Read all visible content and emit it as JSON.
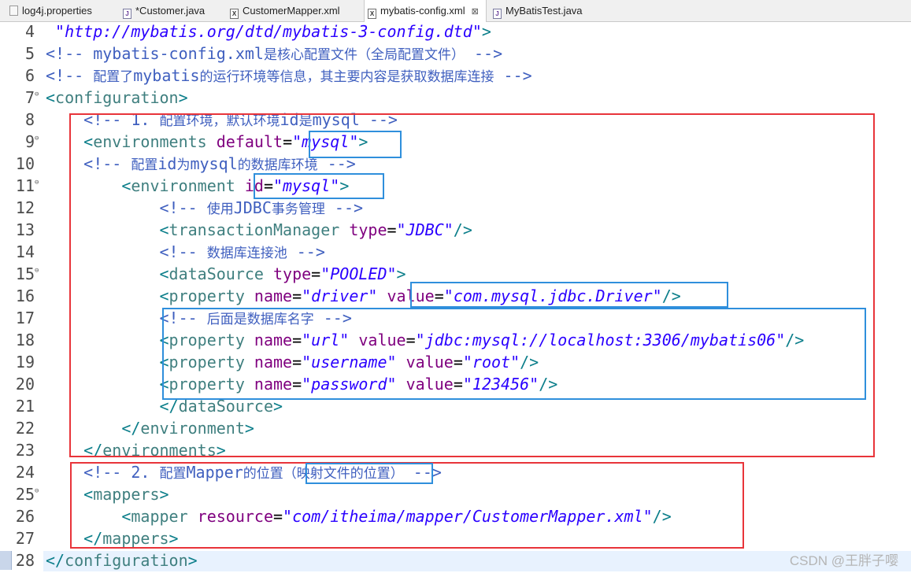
{
  "tabs": [
    {
      "label": "log4j.properties",
      "icon": "properties-file-icon"
    },
    {
      "label": "*Customer.java",
      "icon": "java-file-icon"
    },
    {
      "label": "CustomerMapper.xml",
      "icon": "xml-file-icon"
    },
    {
      "label": "mybatis-config.xml",
      "icon": "xml-file-icon",
      "active": true,
      "close": "⊠"
    },
    {
      "label": "MyBatisTest.java",
      "icon": "java-file-icon"
    }
  ],
  "lines": [
    {
      "n": "4",
      "fold": "",
      "segs": [
        {
          "c": "t-val",
          "t": " \"http://mybatis.org/dtd/mybatis-3-config.dtd\""
        },
        {
          "c": "t-tag",
          "t": ">"
        }
      ]
    },
    {
      "n": "5",
      "fold": "",
      "segs": [
        {
          "c": "t-com",
          "t": "<!-- mybatis-config.xml"
        },
        {
          "c": "t-cjk",
          "t": "是核心配置文件（全局配置文件）"
        },
        {
          "c": "t-com",
          "t": " -->"
        }
      ]
    },
    {
      "n": "6",
      "fold": "",
      "segs": [
        {
          "c": "t-com",
          "t": "<!-- "
        },
        {
          "c": "t-cjk",
          "t": "配置了"
        },
        {
          "c": "t-com",
          "t": "mybatis"
        },
        {
          "c": "t-cjk",
          "t": "的运行环境等信息，其主要内容是获取数据库连接"
        },
        {
          "c": "t-com",
          "t": " -->"
        }
      ]
    },
    {
      "n": "7",
      "fold": "⊖",
      "segs": [
        {
          "c": "t-tag",
          "t": "<"
        },
        {
          "c": "t-el",
          "t": "configuration"
        },
        {
          "c": "t-tag",
          "t": ">"
        }
      ]
    },
    {
      "n": "8",
      "fold": "",
      "segs": [
        {
          "c": "t-com",
          "t": "    <!-- 1. "
        },
        {
          "c": "t-cjk",
          "t": "配置环境，默认环境"
        },
        {
          "c": "t-com",
          "t": "id"
        },
        {
          "c": "t-cjk",
          "t": "是"
        },
        {
          "c": "t-com",
          "t": "mysql -->"
        }
      ]
    },
    {
      "n": "9",
      "fold": "⊖",
      "segs": [
        {
          "c": "t-tag",
          "t": "    <"
        },
        {
          "c": "t-el",
          "t": "environments "
        },
        {
          "c": "t-attr",
          "t": "default"
        },
        {
          "c": "t-txt",
          "t": "="
        },
        {
          "c": "t-val",
          "t": "\"mysql\""
        },
        {
          "c": "t-tag",
          "t": ">"
        }
      ]
    },
    {
      "n": "10",
      "fold": "",
      "segs": [
        {
          "c": "t-com",
          "t": "    <!-- "
        },
        {
          "c": "t-cjk",
          "t": "配置"
        },
        {
          "c": "t-com",
          "t": "id"
        },
        {
          "c": "t-cjk",
          "t": "为"
        },
        {
          "c": "t-com",
          "t": "mysql"
        },
        {
          "c": "t-cjk",
          "t": "的数据库环境"
        },
        {
          "c": "t-com",
          "t": " -->"
        }
      ]
    },
    {
      "n": "11",
      "fold": "⊖",
      "segs": [
        {
          "c": "t-tag",
          "t": "        <"
        },
        {
          "c": "t-el",
          "t": "environment "
        },
        {
          "c": "t-attr",
          "t": "id"
        },
        {
          "c": "t-txt",
          "t": "="
        },
        {
          "c": "t-val",
          "t": "\"mysql\""
        },
        {
          "c": "t-tag",
          "t": ">"
        }
      ]
    },
    {
      "n": "12",
      "fold": "",
      "segs": [
        {
          "c": "t-com",
          "t": "            <!-- "
        },
        {
          "c": "t-cjk",
          "t": "使用"
        },
        {
          "c": "t-com",
          "t": "JDBC"
        },
        {
          "c": "t-cjk",
          "t": "事务管理"
        },
        {
          "c": "t-com",
          "t": " -->"
        }
      ]
    },
    {
      "n": "13",
      "fold": "",
      "segs": [
        {
          "c": "t-tag",
          "t": "            <"
        },
        {
          "c": "t-el",
          "t": "transactionManager "
        },
        {
          "c": "t-attr",
          "t": "type"
        },
        {
          "c": "t-txt",
          "t": "="
        },
        {
          "c": "t-val",
          "t": "\"JDBC\""
        },
        {
          "c": "t-tag",
          "t": "/>"
        }
      ]
    },
    {
      "n": "14",
      "fold": "",
      "segs": [
        {
          "c": "t-com",
          "t": "            <!-- "
        },
        {
          "c": "t-cjk",
          "t": "数据库连接池"
        },
        {
          "c": "t-com",
          "t": " -->"
        }
      ]
    },
    {
      "n": "15",
      "fold": "⊖",
      "segs": [
        {
          "c": "t-tag",
          "t": "            <"
        },
        {
          "c": "t-el",
          "t": "dataSource "
        },
        {
          "c": "t-attr",
          "t": "type"
        },
        {
          "c": "t-txt",
          "t": "="
        },
        {
          "c": "t-val",
          "t": "\"POOLED\""
        },
        {
          "c": "t-tag",
          "t": ">"
        }
      ]
    },
    {
      "n": "16",
      "fold": "",
      "segs": [
        {
          "c": "t-tag",
          "t": "            <"
        },
        {
          "c": "t-el",
          "t": "property "
        },
        {
          "c": "t-attr",
          "t": "name"
        },
        {
          "c": "t-txt",
          "t": "="
        },
        {
          "c": "t-val",
          "t": "\"driver\" "
        },
        {
          "c": "t-attr",
          "t": "value"
        },
        {
          "c": "t-txt",
          "t": "="
        },
        {
          "c": "t-val",
          "t": "\"com.mysql.jdbc.Driver\""
        },
        {
          "c": "t-tag",
          "t": "/>"
        }
      ]
    },
    {
      "n": "17",
      "fold": "",
      "segs": [
        {
          "c": "t-com",
          "t": "            <!-- "
        },
        {
          "c": "t-cjk",
          "t": "后面是数据库名字"
        },
        {
          "c": "t-com",
          "t": " -->"
        }
      ]
    },
    {
      "n": "18",
      "fold": "",
      "segs": [
        {
          "c": "t-tag",
          "t": "            <"
        },
        {
          "c": "t-el",
          "t": "property "
        },
        {
          "c": "t-attr",
          "t": "name"
        },
        {
          "c": "t-txt",
          "t": "="
        },
        {
          "c": "t-val",
          "t": "\"url\" "
        },
        {
          "c": "t-attr",
          "t": "value"
        },
        {
          "c": "t-txt",
          "t": "="
        },
        {
          "c": "t-val",
          "t": "\"jdbc:mysql://localhost:3306/mybatis06\""
        },
        {
          "c": "t-tag",
          "t": "/>"
        }
      ]
    },
    {
      "n": "19",
      "fold": "",
      "segs": [
        {
          "c": "t-tag",
          "t": "            <"
        },
        {
          "c": "t-el",
          "t": "property "
        },
        {
          "c": "t-attr",
          "t": "name"
        },
        {
          "c": "t-txt",
          "t": "="
        },
        {
          "c": "t-val",
          "t": "\"username\" "
        },
        {
          "c": "t-attr",
          "t": "value"
        },
        {
          "c": "t-txt",
          "t": "="
        },
        {
          "c": "t-val",
          "t": "\"root\""
        },
        {
          "c": "t-tag",
          "t": "/>"
        }
      ]
    },
    {
      "n": "20",
      "fold": "",
      "segs": [
        {
          "c": "t-tag",
          "t": "            <"
        },
        {
          "c": "t-el",
          "t": "property "
        },
        {
          "c": "t-attr",
          "t": "name"
        },
        {
          "c": "t-txt",
          "t": "="
        },
        {
          "c": "t-val",
          "t": "\"password\" "
        },
        {
          "c": "t-attr",
          "t": "value"
        },
        {
          "c": "t-txt",
          "t": "="
        },
        {
          "c": "t-val",
          "t": "\"123456\""
        },
        {
          "c": "t-tag",
          "t": "/>"
        }
      ]
    },
    {
      "n": "21",
      "fold": "",
      "segs": [
        {
          "c": "t-tag",
          "t": "            </"
        },
        {
          "c": "t-el",
          "t": "dataSource"
        },
        {
          "c": "t-tag",
          "t": ">"
        }
      ]
    },
    {
      "n": "22",
      "fold": "",
      "segs": [
        {
          "c": "t-tag",
          "t": "        </"
        },
        {
          "c": "t-el",
          "t": "environment"
        },
        {
          "c": "t-tag",
          "t": ">"
        }
      ]
    },
    {
      "n": "23",
      "fold": "",
      "segs": [
        {
          "c": "t-tag",
          "t": "    </"
        },
        {
          "c": "t-el",
          "t": "environments"
        },
        {
          "c": "t-tag",
          "t": ">"
        }
      ]
    },
    {
      "n": "24",
      "fold": "",
      "segs": [
        {
          "c": "t-com",
          "t": "    <!-- 2. "
        },
        {
          "c": "t-cjk",
          "t": "配置"
        },
        {
          "c": "t-com",
          "t": "Mapper"
        },
        {
          "c": "t-cjk",
          "t": "的位置（映射文件的位置）"
        },
        {
          "c": "t-com",
          "t": " -->"
        }
      ]
    },
    {
      "n": "25",
      "fold": "⊖",
      "segs": [
        {
          "c": "t-tag",
          "t": "    <"
        },
        {
          "c": "t-el",
          "t": "mappers"
        },
        {
          "c": "t-tag",
          "t": ">"
        }
      ]
    },
    {
      "n": "26",
      "fold": "",
      "segs": [
        {
          "c": "t-tag",
          "t": "        <"
        },
        {
          "c": "t-el",
          "t": "mapper "
        },
        {
          "c": "t-attr",
          "t": "resource"
        },
        {
          "c": "t-txt",
          "t": "="
        },
        {
          "c": "t-val",
          "t": "\"com/itheima/mapper/CustomerMapper.xml\""
        },
        {
          "c": "t-tag",
          "t": "/>"
        }
      ]
    },
    {
      "n": "27",
      "fold": "",
      "segs": [
        {
          "c": "t-tag",
          "t": "    </"
        },
        {
          "c": "t-el",
          "t": "mappers"
        },
        {
          "c": "t-tag",
          "t": ">"
        }
      ]
    },
    {
      "n": "28",
      "fold": "",
      "segs": [
        {
          "c": "t-tag",
          "t": "</"
        },
        {
          "c": "t-el",
          "t": "configuration"
        },
        {
          "c": "t-tag",
          "t": ">"
        }
      ]
    }
  ],
  "watermark": "CSDN @王胖子嘤",
  "colors": {
    "annotation_red": "#e8343a",
    "annotation_blue": "#2f8fdc"
  }
}
